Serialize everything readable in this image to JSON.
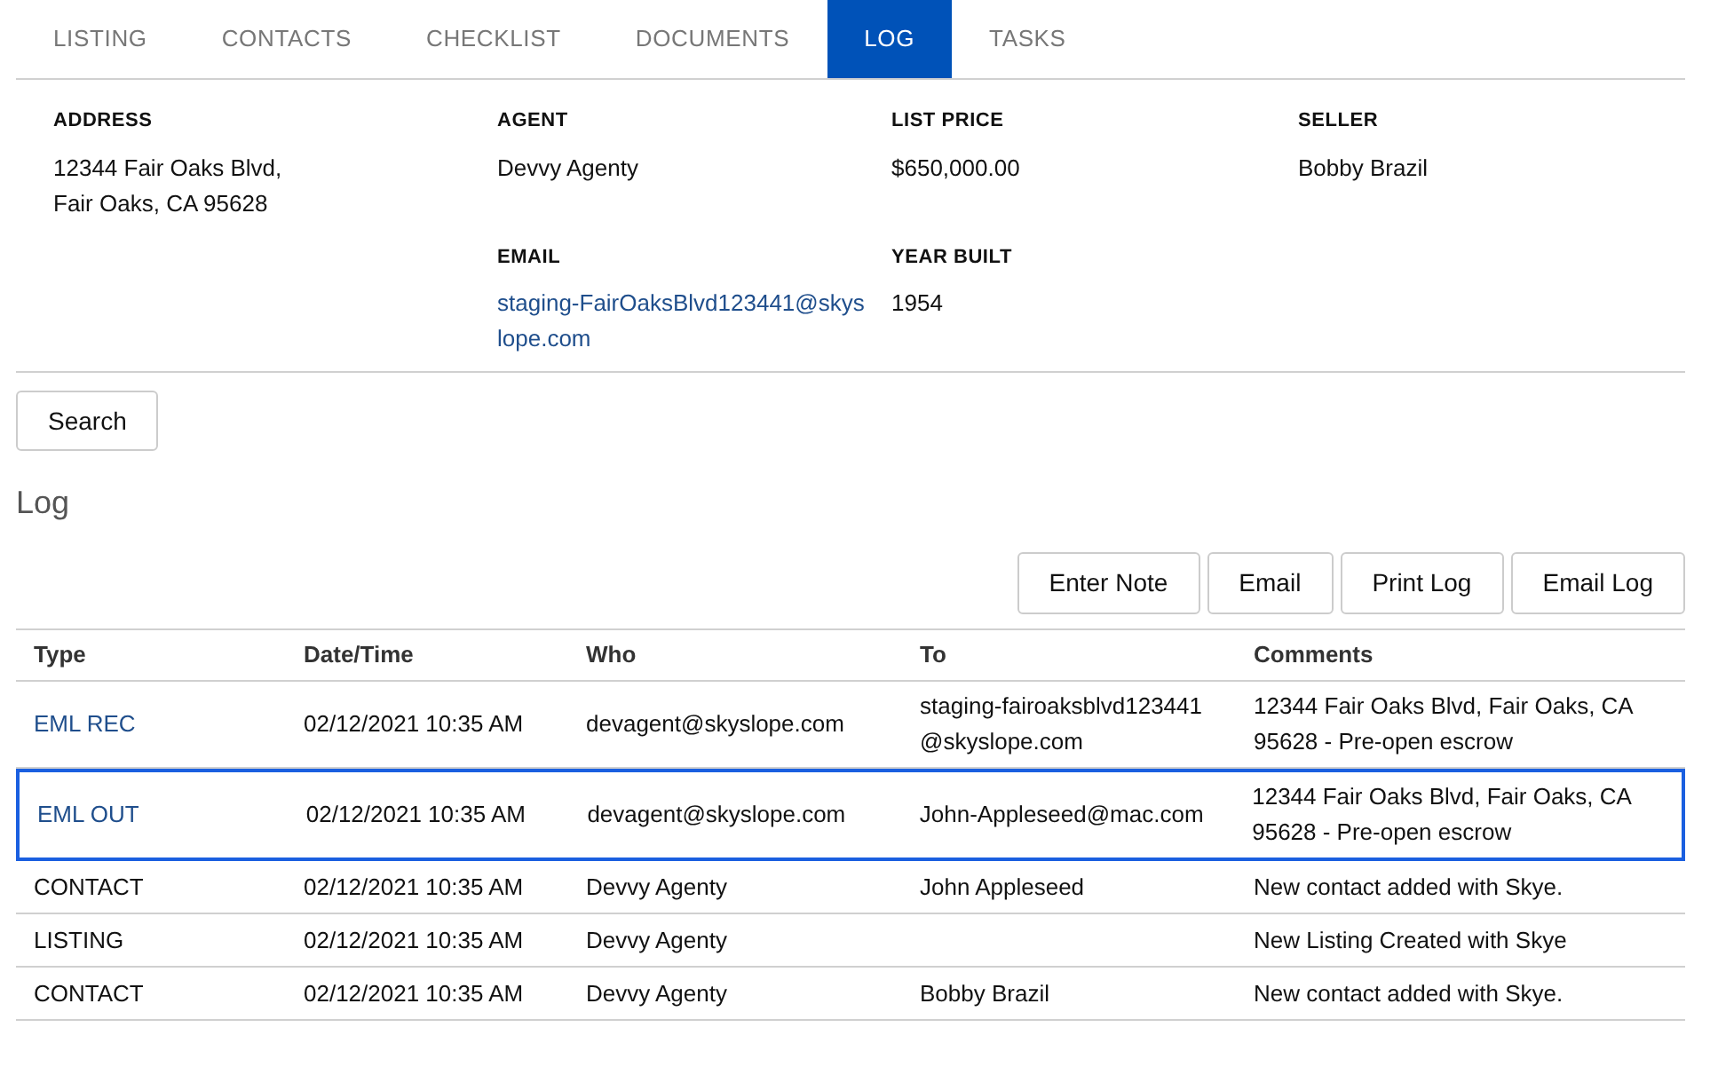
{
  "tabs": [
    {
      "label": "LISTING",
      "selected": false
    },
    {
      "label": "CONTACTS",
      "selected": false
    },
    {
      "label": "CHECKLIST",
      "selected": false
    },
    {
      "label": "DOCUMENTS",
      "selected": false
    },
    {
      "label": "LOG",
      "selected": true
    },
    {
      "label": "TASKS",
      "selected": false
    }
  ],
  "details": [
    {
      "label": "ADDRESS",
      "value": "12344 Fair Oaks Blvd, Fair Oaks, CA 95628",
      "kind": "text"
    },
    {
      "label": "AGENT",
      "value": "Devvy Agenty",
      "kind": "text"
    },
    {
      "label": "LIST PRICE",
      "value": "$650,000.00",
      "kind": "text"
    },
    {
      "label": "SELLER",
      "value": "Bobby Brazil",
      "kind": "text"
    },
    {
      "label": "EMAIL",
      "value": "staging-FairOaksBlvd123441@skyslope.com",
      "kind": "link"
    },
    {
      "label": "YEAR BUILT",
      "value": "1954",
      "kind": "text"
    }
  ],
  "search_button": "Search",
  "section_title": "Log",
  "log_buttons": [
    "Enter Note",
    "Email",
    "Print Log",
    "Email Log"
  ],
  "table": {
    "columns": [
      "Type",
      "Date/Time",
      "Who",
      "To",
      "Comments"
    ],
    "rows": [
      {
        "type": "EML REC",
        "kind": "link",
        "selected": false,
        "datetime": "02/12/2021 10:35 AM",
        "who": "devagent@skyslope.com",
        "to": "staging-fairoaksblvd123441@skyslope.com",
        "comments": "12344 Fair Oaks Blvd, Fair Oaks, CA 95628 - Pre-open escrow"
      },
      {
        "type": "EML OUT",
        "kind": "link",
        "selected": true,
        "datetime": "02/12/2021 10:35 AM",
        "who": "devagent@skyslope.com",
        "to": "John-Appleseed@mac.com",
        "comments": "12344 Fair Oaks Blvd, Fair Oaks, CA 95628 - Pre-open escrow"
      },
      {
        "type": "CONTACT",
        "kind": "text",
        "selected": false,
        "datetime": "02/12/2021 10:35 AM",
        "who": "Devvy Agenty",
        "to": "John Appleseed",
        "comments": "New contact added with Skye."
      },
      {
        "type": "LISTING",
        "kind": "text",
        "selected": false,
        "datetime": "02/12/2021 10:35 AM",
        "who": "Devvy Agenty",
        "comments": "New Listing Created with Skye"
      },
      {
        "type": "CONTACT",
        "kind": "text",
        "selected": false,
        "datetime": "02/12/2021 10:35 AM",
        "who": "Devvy Agenty",
        "to": "Bobby Brazil",
        "comments": "New contact added with Skye."
      }
    ]
  }
}
